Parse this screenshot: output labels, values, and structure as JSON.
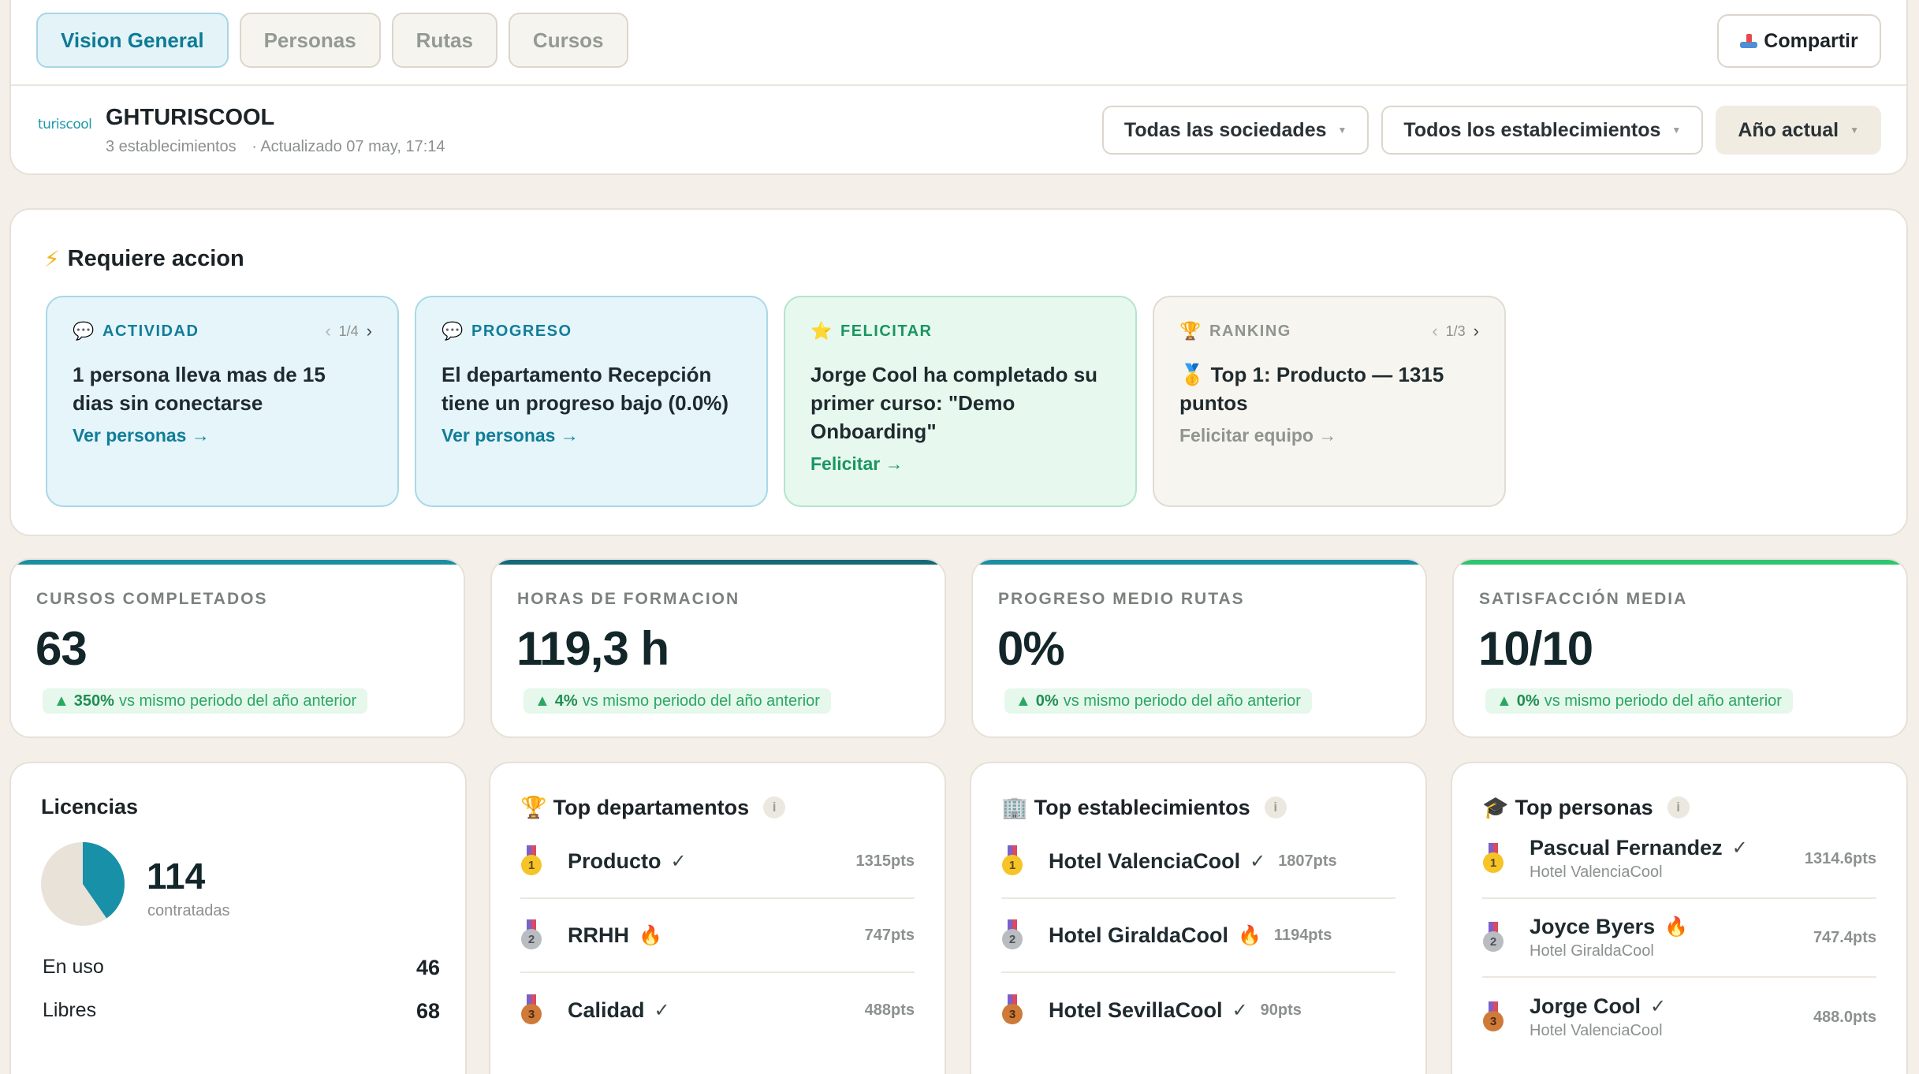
{
  "tabs": [
    {
      "label": "Vision General",
      "active": true
    },
    {
      "label": "Personas",
      "active": false
    },
    {
      "label": "Rutas",
      "active": false
    },
    {
      "label": "Cursos",
      "active": false
    }
  ],
  "share": {
    "label": "Compartir",
    "icon": "share-icon"
  },
  "org": {
    "logo_text": "turiscool",
    "name": "GHTURISCOOL",
    "establishments": "3 establecimientos",
    "updated": "· Actualizado 07 may, 17:14"
  },
  "filters": {
    "societies": "Todas las sociedades",
    "establishments": "Todos los establecimientos",
    "year": "Año actual"
  },
  "actions": {
    "title": "Requiere accion",
    "cards": [
      {
        "tag": "ACTIVIDAD",
        "pager": "1/4",
        "text": "1 persona lleva mas de 15 dias sin conectarse",
        "link": "Ver personas →",
        "icon": "speech-bubble-icon"
      },
      {
        "tag": "PROGRESO",
        "pager": "",
        "text": "El departamento Recepción tiene un progreso bajo (0.0%)",
        "link": "Ver personas →",
        "icon": "speech-bubble-icon"
      },
      {
        "tag": "FELICITAR",
        "pager": "",
        "text": "Jorge Cool ha completado su primer curso: \"Demo Onboarding\"",
        "link": "Felicitar →",
        "icon": "star-icon"
      },
      {
        "tag": "RANKING",
        "pager": "1/3",
        "text": "Top 1: Producto — 1315 puntos",
        "link": "Felicitar equipo →",
        "icon": "trophy-icon"
      }
    ]
  },
  "kpis": [
    {
      "label": "CURSOS COMPLETADOS",
      "value": "63",
      "delta": "350%",
      "delta_text": "vs mismo periodo del año anterior",
      "bar_color": "#1a8ea3"
    },
    {
      "label": "HORAS DE FORMACION",
      "value": "119,3 h",
      "delta": "4%",
      "delta_text": "vs mismo periodo del año anterior",
      "bar_color": "#16697a"
    },
    {
      "label": "PROGRESO MEDIO RUTAS",
      "value": "0%",
      "delta": "0%",
      "delta_text": "vs mismo periodo del año anterior",
      "bar_color": "#1a8ea3"
    },
    {
      "label": "SATISFACCIÓN MEDIA",
      "value": "10/10",
      "delta": "0%",
      "delta_text": "vs mismo periodo del año anterior",
      "bar_color": "#2fc46e"
    }
  ],
  "licenses": {
    "title": "Licencias",
    "total": "114",
    "total_label": "contratadas",
    "in_use_label": "En uso",
    "in_use": "46",
    "free_label": "Libres",
    "free": "68",
    "in_use_color": "#1790a8",
    "free_color": "#e8e2d8"
  },
  "top_departments": {
    "title": "Top departamentos",
    "items": [
      {
        "rank": "1",
        "name": "Producto",
        "mark": "✓",
        "pts": "1315pts"
      },
      {
        "rank": "2",
        "name": "RRHH",
        "mark": "🔥",
        "pts": "747pts"
      },
      {
        "rank": "3",
        "name": "Calidad",
        "mark": "✓",
        "pts": "488pts"
      }
    ]
  },
  "top_establishments": {
    "title": "Top establecimientos",
    "items": [
      {
        "rank": "1",
        "name": "Hotel ValenciaCool",
        "mark": "✓",
        "pts": "1807pts"
      },
      {
        "rank": "2",
        "name": "Hotel GiraldaCool",
        "mark": "🔥",
        "pts": "1194pts"
      },
      {
        "rank": "3",
        "name": "Hotel SevillaCool",
        "mark": "✓",
        "pts": "90pts"
      }
    ]
  },
  "top_people": {
    "title": "Top personas",
    "items": [
      {
        "rank": "1",
        "name": "Pascual Fernandez",
        "mark": "✓",
        "hotel": "Hotel ValenciaCool",
        "pts": "1314.6pts"
      },
      {
        "rank": "2",
        "name": "Joyce Byers",
        "mark": "🔥",
        "hotel": "Hotel GiraldaCool",
        "pts": "747.4pts"
      },
      {
        "rank": "3",
        "name": "Jorge Cool",
        "mark": "✓",
        "hotel": "Hotel ValenciaCool",
        "pts": "488.0pts"
      }
    ]
  }
}
